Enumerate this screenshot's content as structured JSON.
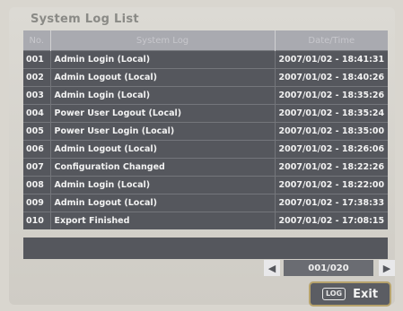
{
  "title": "System Log List",
  "table": {
    "headers": [
      "No.",
      "System Log",
      "Date/Time"
    ],
    "rows": [
      {
        "no": "001",
        "log": "Admin Login (Local)",
        "datetime": "2007/01/02 - 18:41:31"
      },
      {
        "no": "002",
        "log": "Admin Logout (Local)",
        "datetime": "2007/01/02 - 18:40:26"
      },
      {
        "no": "003",
        "log": "Admin Login (Local)",
        "datetime": "2007/01/02 - 18:35:26"
      },
      {
        "no": "004",
        "log": "Power User Logout (Local)",
        "datetime": "2007/01/02 - 18:35:24"
      },
      {
        "no": "005",
        "log": "Power User Login (Local)",
        "datetime": "2007/01/02 - 18:35:00"
      },
      {
        "no": "006",
        "log": "Admin Logout (Local)",
        "datetime": "2007/01/02 - 18:26:06"
      },
      {
        "no": "007",
        "log": "Configuration Changed",
        "datetime": "2007/01/02 - 18:22:26"
      },
      {
        "no": "008",
        "log": "Admin Login (Local)",
        "datetime": "2007/01/02 - 18:22:00"
      },
      {
        "no": "009",
        "log": "Admin Logout (Local)",
        "datetime": "2007/01/02 - 17:38:33"
      },
      {
        "no": "010",
        "log": "Export Finished",
        "datetime": "2007/01/02 - 17:08:15"
      }
    ]
  },
  "pager": {
    "label": "001/020",
    "prev_icon": "left-arrow-icon",
    "next_icon": "right-arrow-icon"
  },
  "exit": {
    "key_label": "LOG",
    "label": "Exit"
  },
  "colors": {
    "row_background": "#55575d",
    "header_background": "#a9aab0",
    "exit_border": "#b7a36c"
  }
}
